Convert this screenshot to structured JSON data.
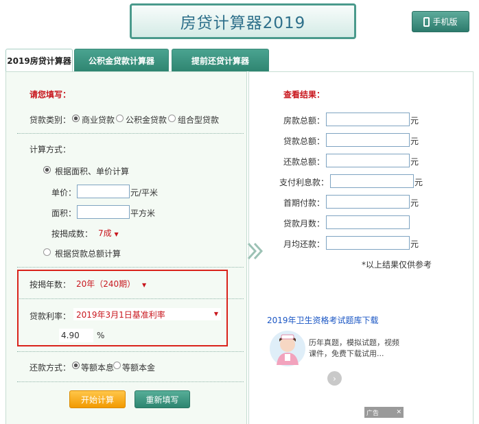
{
  "header": {
    "title": "房贷计算器2019",
    "mobile_label": "手机版"
  },
  "tabs": [
    "2019房贷计算器",
    "公积金贷款计算器",
    "提前还贷计算器"
  ],
  "form": {
    "fill_heading": "请您填写：",
    "loan_type_label": "贷款类别：",
    "loan_types": [
      "商业贷款",
      "公积金贷款",
      "组合型贷款"
    ],
    "calc_method_label": "计算方式：",
    "method_area": "根据面积、单价计算",
    "unit_price_label": "单价：",
    "unit_price_unit": "元/平米",
    "area_label": "面积：",
    "area_unit": "平方米",
    "ratio_label": "按揭成数：",
    "ratio_value": "7成",
    "method_total": "根据贷款总额计算",
    "years_label": "按揭年数：",
    "years_value": "20年（240期）",
    "rate_label": "贷款利率：",
    "rate_value": "2019年3月1日基准利率",
    "rate_number": "4.90",
    "rate_unit": "%",
    "repay_label": "还款方式：",
    "repay_options": [
      "等额本息",
      "等额本金"
    ],
    "start_button": "开始计算",
    "reset_button": "重新填写"
  },
  "results": {
    "heading": "查看结果：",
    "rows": [
      {
        "label": "房款总额：",
        "unit": "元"
      },
      {
        "label": "贷款总额：",
        "unit": "元"
      },
      {
        "label": "还款总额：",
        "unit": "元"
      },
      {
        "label": "支付利息款：",
        "unit": "元"
      },
      {
        "label": "首期付款：",
        "unit": "元"
      },
      {
        "label": "贷款月数：",
        "unit": ""
      },
      {
        "label": "月均还款：",
        "unit": "元"
      }
    ],
    "note": "*以上结果仅供参考"
  },
  "ad": {
    "title": "2019年卫生资格考试题库下载",
    "desc": "历年真题，模拟试题，视频课件，免费下载试用...",
    "tag": "广告"
  },
  "colors": {
    "accent": "#2f8571",
    "highlight": "#c8161d",
    "link": "#1a56c4"
  }
}
